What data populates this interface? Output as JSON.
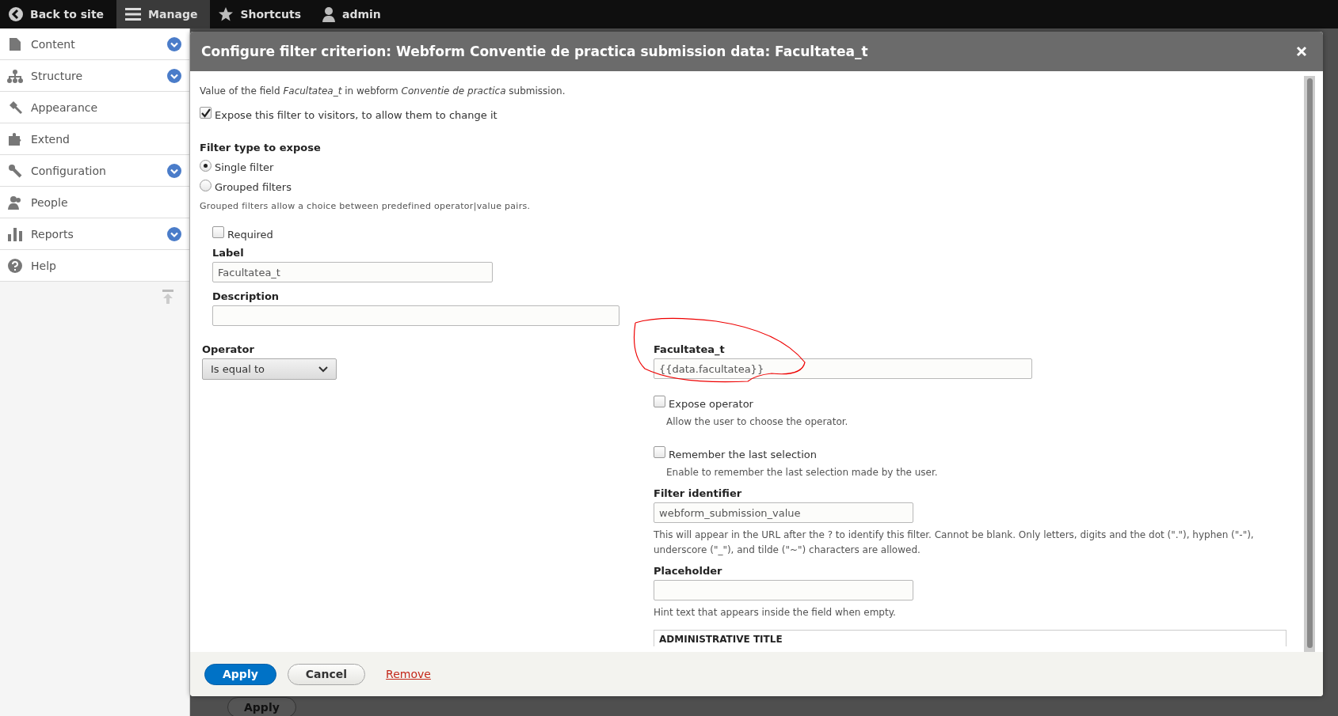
{
  "toolbar": {
    "items": [
      {
        "label": "Back to site",
        "selected": false
      },
      {
        "label": "Manage",
        "selected": true
      },
      {
        "label": "Shortcuts",
        "selected": false
      },
      {
        "label": "admin",
        "selected": false
      }
    ]
  },
  "sidebar": {
    "items": [
      {
        "label": "Content",
        "expandable": true
      },
      {
        "label": "Structure",
        "expandable": true
      },
      {
        "label": "Appearance",
        "expandable": false
      },
      {
        "label": "Extend",
        "expandable": false
      },
      {
        "label": "Configuration",
        "expandable": true
      },
      {
        "label": "People",
        "expandable": false
      },
      {
        "label": "Reports",
        "expandable": true
      },
      {
        "label": "Help",
        "expandable": false
      }
    ]
  },
  "dialog": {
    "title": "Configure filter criterion: Webform Conventie de practica submission data: Facultatea_t",
    "description": "Value of the field *Facultatea_t* in webform *Conventie de practica* submission.",
    "expose_checkbox": {
      "label": "Expose this filter to visitors, to allow them to change it",
      "checked": true
    },
    "filter_type": {
      "heading": "Filter type to expose",
      "options": [
        {
          "label": "Single filter",
          "selected": true
        },
        {
          "label": "Grouped filters",
          "selected": false
        }
      ],
      "help": "Grouped filters allow a choice between predefined operator|value pairs."
    },
    "required": {
      "label": "Required",
      "checked": false
    },
    "label_field": {
      "label": "Label",
      "value": "Facultatea_t"
    },
    "description_field": {
      "label": "Description"
    },
    "operator": {
      "label": "Operator",
      "value": "Is equal to"
    },
    "value_field": {
      "label": "Facultatea_t",
      "value": "{{data.facultatea}}"
    },
    "expose_operator": {
      "label": "Expose operator",
      "checked": false,
      "help": "Allow the user to choose the operator."
    },
    "remember": {
      "label": "Remember the last selection",
      "checked": false,
      "help": "Enable to remember the last selection made by the user."
    },
    "filter_identifier": {
      "label": "Filter identifier",
      "value": "webform_submission_value",
      "help": "This will appear in the URL after the ? to identify this filter. Cannot be blank. Only letters, digits and the dot (\".\"), hyphen (\"-\"), underscore (\"_\"), and tilde (\"~\") characters are allowed."
    },
    "placeholder_field": {
      "label": "Placeholder",
      "help": "Hint text that appears inside the field when empty."
    },
    "admin_title": {
      "heading": "ADMINISTRATIVE TITLE"
    },
    "buttons": [
      {
        "label": "Apply",
        "kind": "primary"
      },
      {
        "label": "Cancel",
        "kind": "secondary"
      },
      {
        "label": "Remove",
        "kind": "link"
      }
    ]
  },
  "background": {
    "button": "Apply"
  }
}
